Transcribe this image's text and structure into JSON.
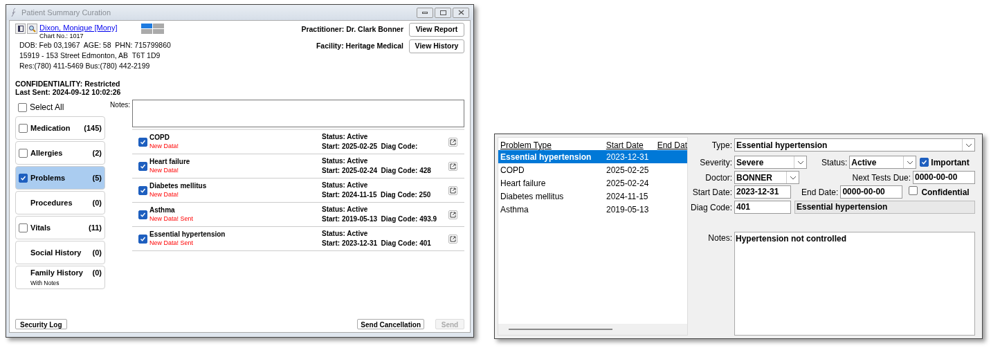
{
  "window": {
    "title": "Patient Summary Curation"
  },
  "patient": {
    "name": "Dixon, Monique [Mony]",
    "chart_no": "Chart No.: 1017",
    "lines": [
      "DOB: Feb 03,1967  AGE: 58  PHN: 715799860",
      "15919 - 153 Street Edmonton, AB  T6T 1D9",
      "Res:(780) 411-5469 Bus:(780) 442-2199"
    ],
    "confidentiality": "CONFIDENTIALITY: Restricted",
    "last_sent": "Last Sent: 2024-09-12 10:02:26"
  },
  "practitioner": "Practitioner: Dr. Clark Bonner",
  "facility": "Facility: Heritage Medical",
  "header_buttons": [
    "View Report",
    "View History"
  ],
  "select_all": {
    "label": "Select All",
    "checked": false
  },
  "notes_label": "Notes:",
  "categories": [
    {
      "kind": "checkbox",
      "label": "Medication",
      "count": "(145)",
      "checked": false,
      "selected": false
    },
    {
      "kind": "checkbox",
      "label": "Allergies",
      "count": "(2)",
      "checked": false,
      "selected": false
    },
    {
      "kind": "checkbox",
      "label": "Problems",
      "count": "(5)",
      "checked": true,
      "selected": true
    },
    {
      "kind": "plain",
      "label": "Procedures",
      "count": "(0)",
      "selected": false
    },
    {
      "kind": "checkbox",
      "label": "Vitals",
      "count": "(11)",
      "checked": false,
      "selected": false
    },
    {
      "kind": "plain",
      "label": "Social History",
      "count": "(0)",
      "selected": false
    },
    {
      "kind": "plain",
      "label": "Family History",
      "count": "(0)",
      "sublabel": "With Notes",
      "selected": false
    }
  ],
  "problems": [
    {
      "name": "COPD",
      "flag": "New Data!",
      "status": "Status: Active",
      "detail": "Start: 2025-02-25  Diag Code:",
      "checked": true
    },
    {
      "name": "Heart failure",
      "flag": "New Data!",
      "status": "Status: Active",
      "detail": "Start: 2025-02-24  Diag Code: 428",
      "checked": true
    },
    {
      "name": "Diabetes mellitus",
      "flag": "New Data!",
      "status": "Status: Active",
      "detail": "Start: 2024-11-15  Diag Code: 250",
      "checked": true
    },
    {
      "name": "Asthma",
      "flag": "New Data! Sent",
      "status": "Status: Active",
      "detail": "Start: 2019-05-13  Diag Code: 493.9",
      "checked": true
    },
    {
      "name": "Essential hypertension",
      "flag": "New Data! Sent",
      "status": "Status: Active",
      "detail": "Start: 2023-12-31  Diag Code: 401",
      "checked": true
    }
  ],
  "footer": {
    "left": "Security Log",
    "right": [
      {
        "label": "Send Cancellation",
        "disabled": false
      },
      {
        "label": "Send",
        "disabled": true
      }
    ]
  },
  "detail": {
    "columns": [
      "Problem Type",
      "Start Date",
      "End Dat"
    ],
    "rows": [
      {
        "type": "Essential hypertension",
        "start": "2023-12-31",
        "selected": true
      },
      {
        "type": "COPD",
        "start": "2025-02-25",
        "selected": false
      },
      {
        "type": "Heart failure",
        "start": "2025-02-24",
        "selected": false
      },
      {
        "type": "Diabetes mellitus",
        "start": "2024-11-15",
        "selected": false
      },
      {
        "type": "Asthma",
        "start": "2019-05-13",
        "selected": false
      }
    ],
    "type": {
      "label": "Type:",
      "value": "Essential hypertension"
    },
    "severity": {
      "label": "Severity:",
      "value": "Severe"
    },
    "status": {
      "label": "Status:",
      "value": "Active"
    },
    "important": {
      "label": "Important",
      "checked": true
    },
    "doctor": {
      "label": "Doctor:",
      "value": "BONNER"
    },
    "next_tests": {
      "label": "Next Tests Due:",
      "value": "0000-00-00"
    },
    "start_date": {
      "label": "Start Date:",
      "value": "2023-12-31"
    },
    "end_date": {
      "label": "End Date:",
      "value": "0000-00-00"
    },
    "confidential": {
      "label": "Confidential",
      "checked": false
    },
    "diag_code": {
      "label": "Diag Code:",
      "value": "401",
      "description": "Essential hypertension"
    },
    "notes": {
      "label": "Notes:",
      "value": "Hypertension not controlled"
    }
  }
}
